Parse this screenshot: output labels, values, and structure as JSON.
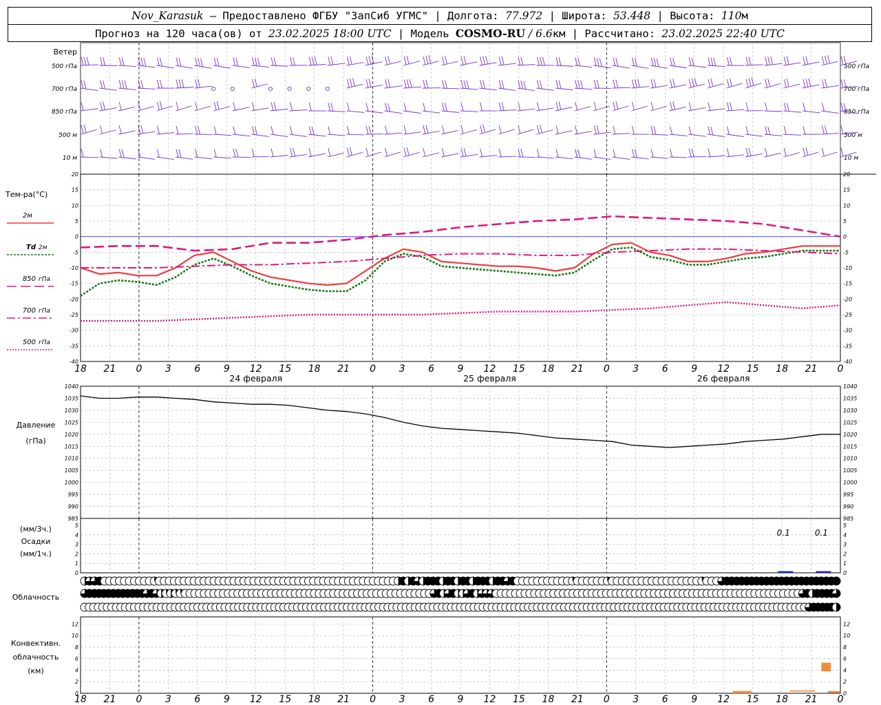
{
  "header": {
    "station": "Nov_Karasuk",
    "dash": " – ",
    "provider": "Предоставлено ФГБУ \"ЗапСиб УГМС\"",
    "sep": " | ",
    "lon_label": "Долгота: ",
    "lon_value": "77.972",
    "lat_label": "Широта: ",
    "lat_value": "53.448",
    "alt_label": "Высота: ",
    "alt_value": "110",
    "alt_unit": "м",
    "forecast_label": "Прогноз на 120 часа(ов) от ",
    "forecast_start": "23.02.2025 18:00 UTC",
    "model_label": " | Модель ",
    "model_name": "COSMO-RU",
    "model_res_sep": " / ",
    "model_res": "6.6",
    "model_res_unit": "км",
    "calc_label": " | Рассчитано: ",
    "calc_time": "23.02.2025 22:40 UTC"
  },
  "colors": {
    "wind": "#7b2fd4",
    "t2m": "#ee3b3b",
    "td2m": "#117711",
    "t850": "#e0157f",
    "t700": "#e0157f",
    "t500": "#e0157f",
    "pressure": "#000000",
    "precip": "#2222cc",
    "convective": "#f08c3c",
    "zero_line": "#3333ff"
  },
  "time_axis": {
    "ticks": [
      "18",
      "21",
      "0",
      "3",
      "6",
      "9",
      "12",
      "15",
      "18",
      "21",
      "0",
      "3",
      "6",
      "9",
      "12",
      "15",
      "18",
      "21",
      "0",
      "3",
      "6",
      "9",
      "12",
      "15",
      "18",
      "21",
      "0"
    ],
    "dates": [
      {
        "label": "24 февраля",
        "at_tick": 6
      },
      {
        "label": "25 февраля",
        "at_tick": 14
      },
      {
        "label": "26 февраля",
        "at_tick": 22
      }
    ]
  },
  "wind_panel": {
    "title": "Ветер",
    "levels": [
      "500 гПа",
      "700 гПа",
      "850 гПа",
      "500 м",
      "10  м"
    ],
    "calm_symbol": "o"
  },
  "chart_data": [
    {
      "type": "line",
      "id": "temperature",
      "title": "Тем-ра(°C)",
      "x_unit": "hours from 23.02.2025 18:00 UTC",
      "ylim": [
        -40,
        20
      ],
      "yticks": [
        20,
        15,
        10,
        5,
        0,
        -5,
        -10,
        -15,
        -20,
        -25,
        -30,
        -35,
        -40
      ],
      "grid": true,
      "legend_placement": "left",
      "series": [
        {
          "name": "2м",
          "style": "solid",
          "x": [
            0,
            3,
            6,
            9,
            12,
            15,
            18,
            21,
            24,
            27,
            30,
            33,
            36,
            39,
            42,
            45,
            48,
            51,
            54,
            57,
            60,
            63,
            66,
            69,
            72,
            75,
            78,
            81,
            84,
            87,
            90,
            93,
            96,
            99,
            102,
            105,
            108,
            111,
            114,
            117,
            120
          ],
          "values": [
            -10,
            -12,
            -11.5,
            -12.5,
            -12.5,
            -10,
            -6,
            -5,
            -8,
            -11,
            -13,
            -14,
            -15,
            -15.5,
            -15,
            -11,
            -7,
            -4,
            -5,
            -8,
            -8.5,
            -9,
            -9.5,
            -9.5,
            -10,
            -11,
            -10,
            -5.5,
            -2.5,
            -2,
            -5,
            -6,
            -8,
            -8,
            -7,
            -5.5,
            -5,
            -4,
            -3,
            -3,
            -3
          ]
        },
        {
          "name": "Td",
          "label_suffix": "2м",
          "style": "dotted",
          "x": [
            0,
            3,
            6,
            9,
            12,
            15,
            18,
            21,
            24,
            27,
            30,
            33,
            36,
            39,
            42,
            45,
            48,
            51,
            54,
            57,
            60,
            63,
            66,
            69,
            72,
            75,
            78,
            81,
            84,
            87,
            90,
            93,
            96,
            99,
            102,
            105,
            108,
            111,
            114,
            117,
            120
          ],
          "values": [
            -19,
            -15,
            -14,
            -14.5,
            -15.5,
            -13,
            -9,
            -7,
            -9.5,
            -12.5,
            -15,
            -16,
            -17,
            -17.5,
            -17.5,
            -14,
            -8,
            -5.5,
            -6.5,
            -9.5,
            -10,
            -10.5,
            -11,
            -11.5,
            -12,
            -12.5,
            -11.5,
            -7.5,
            -4,
            -3.5,
            -6.5,
            -7.5,
            -9,
            -9,
            -8,
            -7,
            -6.5,
            -5.5,
            -4.5,
            -4.5,
            -4.5
          ]
        },
        {
          "name": "850",
          "label_suffix": "гПа",
          "style": "long-dash",
          "x": [
            0,
            6,
            12,
            18,
            24,
            30,
            36,
            42,
            48,
            54,
            60,
            66,
            72,
            78,
            84,
            90,
            96,
            102,
            108,
            114,
            117,
            120
          ],
          "values": [
            -3.5,
            -3,
            -3,
            -4.5,
            -4,
            -2,
            -2,
            -1,
            0.5,
            1.5,
            3,
            4,
            5,
            5.5,
            6.5,
            6,
            5.5,
            5,
            4,
            2,
            1,
            0
          ]
        },
        {
          "name": "700",
          "label_suffix": "гПа",
          "style": "dash-dot",
          "x": [
            0,
            6,
            12,
            18,
            24,
            30,
            36,
            42,
            48,
            54,
            60,
            66,
            72,
            78,
            84,
            90,
            96,
            102,
            108,
            114,
            120
          ],
          "values": [
            -10,
            -10,
            -10,
            -9.5,
            -9,
            -9,
            -8.5,
            -8,
            -7,
            -6,
            -5.5,
            -5.5,
            -6,
            -6,
            -5,
            -4.5,
            -4,
            -4,
            -4.5,
            -5,
            -5.5
          ]
        },
        {
          "name": "500",
          "label_suffix": "гПа",
          "style": "dotted-fine",
          "x": [
            0,
            6,
            12,
            18,
            24,
            30,
            36,
            42,
            48,
            54,
            60,
            66,
            72,
            78,
            84,
            90,
            96,
            102,
            108,
            114,
            120
          ],
          "values": [
            -27,
            -27,
            -27,
            -26.5,
            -26,
            -25.5,
            -25,
            -25,
            -25,
            -25,
            -24.5,
            -24,
            -24,
            -24,
            -23.5,
            -23,
            -22,
            -21,
            -22,
            -23,
            -22
          ]
        }
      ]
    },
    {
      "type": "line",
      "id": "pressure",
      "title": "Давление",
      "unit": "(гПа)",
      "x_unit": "hours from 23.02.2025 18:00 UTC",
      "ylim": [
        985,
        1040
      ],
      "yticks": [
        1040,
        1035,
        1030,
        1025,
        1020,
        1015,
        1010,
        1005,
        1000,
        995,
        990,
        985
      ],
      "grid": true,
      "series": [
        {
          "name": "pressure",
          "x": [
            0,
            3,
            6,
            9,
            12,
            15,
            18,
            21,
            24,
            27,
            30,
            33,
            36,
            39,
            42,
            45,
            48,
            51,
            54,
            57,
            60,
            63,
            66,
            69,
            72,
            75,
            78,
            81,
            84,
            87,
            90,
            93,
            96,
            99,
            102,
            105,
            108,
            111,
            114,
            117,
            120
          ],
          "values": [
            1036,
            1035,
            1035,
            1035.5,
            1035.5,
            1035,
            1034.5,
            1033.5,
            1033,
            1032.5,
            1032.5,
            1032,
            1031,
            1030,
            1029.5,
            1028.5,
            1027,
            1025,
            1023.5,
            1022.5,
            1022,
            1021.5,
            1021,
            1020.5,
            1019.5,
            1018.5,
            1018,
            1017.5,
            1017,
            1015.5,
            1015,
            1014.5,
            1015,
            1015.5,
            1016,
            1017,
            1017.5,
            1018,
            1019,
            1020,
            1020
          ]
        }
      ]
    },
    {
      "type": "bar",
      "id": "precipitation",
      "title": "Осадки",
      "unit_3h": "(мм/3ч.)",
      "unit_1h": "(мм/1ч.)",
      "ylim": [
        0,
        5
      ],
      "yticks": [
        5,
        4,
        3,
        2,
        1,
        0
      ],
      "grid": true,
      "x": [
        111,
        117
      ],
      "values": [
        0.1,
        0.1
      ],
      "data_labels": [
        "0.1",
        "0.1"
      ]
    },
    {
      "type": "table",
      "id": "cloudiness",
      "title": "Облачность",
      "rows": 3,
      "step_hours": 1,
      "legend": "0 empty, 1 quarter, 2 half, 3 three-quarters, 4 full",
      "values": [
        [
          2,
          3,
          3,
          4,
          0,
          0,
          0,
          0,
          0,
          0,
          0,
          0,
          0,
          0,
          1,
          0,
          0,
          0,
          0,
          0,
          0,
          0,
          0,
          0,
          0,
          0,
          0,
          0,
          0,
          0,
          0,
          0,
          0,
          0,
          0,
          0,
          0,
          0,
          0,
          0,
          0,
          0,
          0,
          0,
          0,
          0,
          0,
          0,
          0,
          0,
          0,
          0,
          0,
          0,
          0,
          0,
          0,
          0,
          0,
          0,
          0,
          0,
          0,
          2,
          4,
          2,
          4,
          3,
          2,
          4,
          4,
          4,
          2,
          4,
          4,
          2,
          4,
          4,
          2,
          4,
          4,
          4,
          2,
          4,
          4,
          3,
          4,
          0,
          0,
          0,
          0,
          0,
          0,
          0,
          0,
          0,
          0,
          0,
          1,
          0,
          0,
          0,
          0,
          0,
          0,
          1,
          0,
          0,
          0,
          0,
          0,
          0,
          0,
          0,
          0,
          0,
          0,
          0,
          0,
          0,
          0,
          0,
          0,
          0,
          1,
          0,
          0,
          0,
          3,
          4,
          4,
          4,
          4,
          4,
          4,
          4,
          4,
          4,
          4,
          4,
          4,
          4,
          4,
          4,
          4,
          4,
          4,
          4,
          4,
          4,
          4,
          4
        ],
        [
          3,
          4,
          4,
          4,
          4,
          4,
          4,
          4,
          4,
          4,
          4,
          4,
          4,
          3,
          4,
          3,
          2,
          1,
          2,
          1,
          1,
          0,
          0,
          0,
          0,
          0,
          0,
          0,
          0,
          0,
          0,
          0,
          0,
          0,
          0,
          0,
          0,
          0,
          0,
          0,
          0,
          0,
          0,
          0,
          0,
          0,
          0,
          0,
          0,
          0,
          0,
          0,
          0,
          0,
          0,
          0,
          0,
          0,
          0,
          0,
          0,
          0,
          0,
          0,
          0,
          0,
          0,
          0,
          0,
          0,
          0,
          0,
          0,
          3,
          4,
          2,
          3,
          4,
          2,
          2,
          3,
          4,
          2,
          3,
          3,
          3,
          0,
          0,
          0,
          0,
          0,
          0,
          0,
          0,
          0,
          0,
          0,
          0,
          0,
          0,
          0,
          0,
          0,
          0,
          0,
          0,
          0,
          0,
          0,
          0,
          0,
          0,
          0,
          0,
          0,
          0,
          0,
          0,
          0,
          0,
          0,
          0,
          0,
          0,
          0,
          0,
          0,
          0,
          0,
          0,
          0,
          0,
          0,
          0,
          0,
          0,
          0,
          0,
          0,
          0,
          0,
          0,
          0,
          0,
          0,
          0,
          0,
          0,
          0,
          0,
          3,
          4,
          2,
          4,
          4,
          4,
          4,
          3
        ],
        [
          0,
          0,
          0,
          0,
          0,
          0,
          0,
          0,
          0,
          0,
          0,
          0,
          0,
          0,
          0,
          0,
          0,
          0,
          0,
          0,
          0,
          0,
          0,
          0,
          0,
          0,
          0,
          0,
          0,
          0,
          0,
          0,
          0,
          0,
          0,
          0,
          0,
          0,
          0,
          0,
          0,
          0,
          0,
          0,
          0,
          0,
          0,
          0,
          0,
          0,
          0,
          0,
          0,
          0,
          0,
          0,
          0,
          0,
          0,
          0,
          0,
          0,
          0,
          0,
          0,
          0,
          0,
          0,
          0,
          0,
          0,
          0,
          0,
          0,
          0,
          0,
          0,
          0,
          0,
          0,
          0,
          0,
          0,
          0,
          0,
          0,
          0,
          0,
          0,
          0,
          0,
          0,
          0,
          0,
          0,
          0,
          0,
          0,
          0,
          0,
          0,
          0,
          0,
          0,
          0,
          0,
          0,
          0,
          0,
          0,
          0,
          0,
          0,
          0,
          0,
          0,
          0,
          0,
          0,
          0,
          0,
          0,
          0,
          0,
          0,
          0,
          0,
          0,
          0,
          0,
          0,
          0,
          0,
          0,
          0,
          0,
          0,
          0,
          0,
          0,
          0,
          0,
          0,
          0,
          0,
          0,
          0,
          0,
          0,
          0,
          0,
          0,
          0,
          0,
          0,
          0,
          0,
          0,
          0,
          0,
          3,
          4,
          4,
          4,
          4,
          4,
          2
        ]
      ]
    },
    {
      "type": "bar",
      "id": "convective",
      "title": "Конвективн.",
      "title2": "облачность",
      "unit": "(км)",
      "ylim": [
        0,
        13
      ],
      "yticks": [
        12,
        10,
        8,
        6,
        4,
        2,
        0
      ],
      "grid": true,
      "segments": [
        {
          "x0": 103,
          "x1": 106,
          "bottom": 0,
          "top": 0.4
        },
        {
          "x0": 112,
          "x1": 116,
          "bottom": 0.3,
          "top": 0.5
        },
        {
          "x0": 117,
          "x1": 118.5,
          "bottom": 3.8,
          "top": 5.3
        },
        {
          "x0": 118,
          "x1": 120,
          "bottom": 0.1,
          "top": 0.4
        }
      ]
    }
  ]
}
